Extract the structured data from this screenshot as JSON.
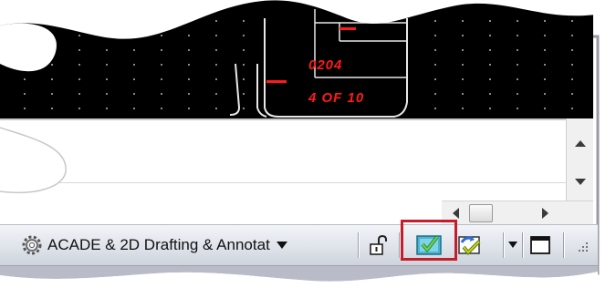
{
  "drawing": {
    "title_block": {
      "sheet_number": "0204",
      "sheet_of": "4 OF 10"
    }
  },
  "status_bar": {
    "workspace_label": "ACADE & 2D Drafting & Annotat",
    "workspace_icon": "gear-icon",
    "lock_icon": "unlock-icon",
    "highlighted_button_icon": "check-monitor-icon",
    "next_button_icon": "refresh-check-icon",
    "menu_arrow_icon": "chevron-down-icon",
    "clean_screen_icon": "window-icon",
    "resize_grip_icon": "resize-grip-icon"
  },
  "colors": {
    "canvas_bg": "#000000",
    "cad_text": "#ff1a1a",
    "highlight_border": "#c41e2a",
    "statusbar_bg": "#dfe3ea"
  }
}
